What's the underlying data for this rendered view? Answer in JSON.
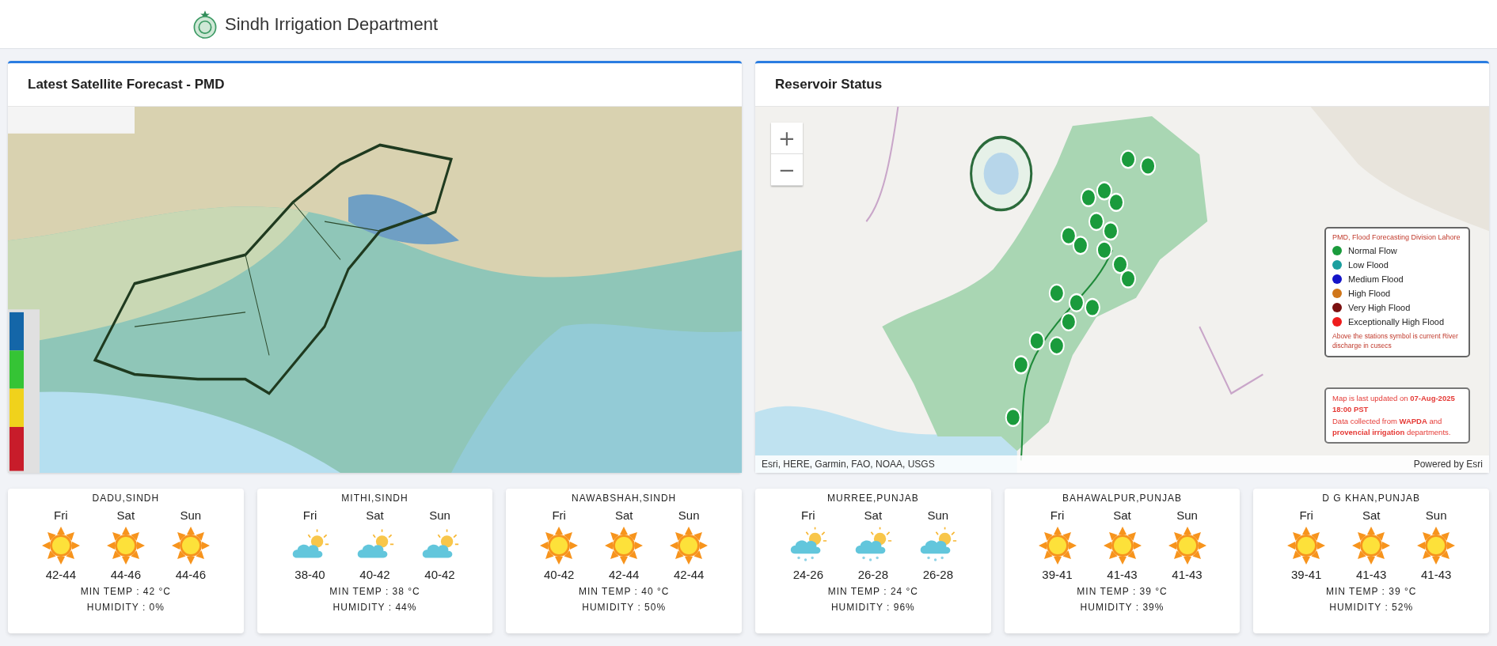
{
  "header": {
    "title": "Sindh Irrigation Department"
  },
  "satellite_panel": {
    "title": "Latest Satellite Forecast - PMD",
    "picture": {
      "kind": "picture"
    }
  },
  "reservoir_panel": {
    "title": "Reservoir Status",
    "picture": {
      "kind": "picture"
    },
    "zoom_controls": [
      "+",
      "−"
    ],
    "legend": {
      "heading": "PMD, Flood Forecasting Division Lahore",
      "items": [
        {
          "label": "Normal Flow",
          "color": "#1a9b3c"
        },
        {
          "label": "Low Flood",
          "color": "#1a9e9e"
        },
        {
          "label": "Medium Flood",
          "color": "#1414c8"
        },
        {
          "label": "High Flood",
          "color": "#d0761a"
        },
        {
          "label": "Very High Flood",
          "color": "#7a1010"
        },
        {
          "label": "Exceptionally High Flood",
          "color": "#ee1c1c"
        }
      ],
      "note": "Above the stations symbol is current River discharge in cusecs"
    },
    "update_note": {
      "text": "Map is last updated on **07-Aug-2025 18:00 PST**",
      "source": "Data collected from **WAPDA** and **provencial irrigation** departments."
    },
    "attribution": "Esri, HERE, Garmin, FAO, NOAA, USGS",
    "powered_by": "Powered by Esri"
  },
  "weather_cards": [
    {
      "city": "DADU,SINDH",
      "days": [
        {
          "day": "Fri",
          "kind": "sunny",
          "range": "42-44"
        },
        {
          "day": "Sat",
          "kind": "sunny",
          "range": "44-46"
        },
        {
          "day": "Sun",
          "kind": "sunny",
          "range": "44-46"
        }
      ],
      "min_temp": "MIN TEMP : 42 °C",
      "humidity": "HUMIDITY : 0%"
    },
    {
      "city": "MITHI,SINDH",
      "days": [
        {
          "day": "Fri",
          "kind": "partly_cloudy",
          "range": "38-40"
        },
        {
          "day": "Sat",
          "kind": "partly_cloudy",
          "range": "40-42"
        },
        {
          "day": "Sun",
          "kind": "partly_cloudy",
          "range": "40-42"
        }
      ],
      "min_temp": "MIN TEMP : 38 °C",
      "humidity": "HUMIDITY : 44%"
    },
    {
      "city": "NAWABSHAH,SINDH",
      "days": [
        {
          "day": "Fri",
          "kind": "sunny",
          "range": "40-42"
        },
        {
          "day": "Sat",
          "kind": "sunny",
          "range": "42-44"
        },
        {
          "day": "Sun",
          "kind": "sunny",
          "range": "42-44"
        }
      ],
      "min_temp": "MIN TEMP : 40 °C",
      "humidity": "HUMIDITY : 50%"
    },
    {
      "city": "MURREE,PUNJAB",
      "days": [
        {
          "day": "Fri",
          "kind": "rain",
          "range": "24-26"
        },
        {
          "day": "Sat",
          "kind": "rain",
          "range": "26-28"
        },
        {
          "day": "Sun",
          "kind": "rain",
          "range": "26-28"
        }
      ],
      "min_temp": "MIN TEMP : 24 °C",
      "humidity": "HUMIDITY : 96%"
    },
    {
      "city": "BAHAWALPUR,PUNJAB",
      "days": [
        {
          "day": "Fri",
          "kind": "sunny",
          "range": "39-41"
        },
        {
          "day": "Sat",
          "kind": "sunny",
          "range": "41-43"
        },
        {
          "day": "Sun",
          "kind": "sunny",
          "range": "41-43"
        }
      ],
      "min_temp": "MIN TEMP : 39 °C",
      "humidity": "HUMIDITY : 39%"
    },
    {
      "city": "D G KHAN,PUNJAB",
      "days": [
        {
          "day": "Fri",
          "kind": "sunny",
          "range": "39-41"
        },
        {
          "day": "Sat",
          "kind": "sunny",
          "range": "41-43"
        },
        {
          "day": "Sun",
          "kind": "sunny",
          "range": "41-43"
        }
      ],
      "min_temp": "MIN TEMP : 39 °C",
      "humidity": "HUMIDITY : 52%"
    }
  ]
}
